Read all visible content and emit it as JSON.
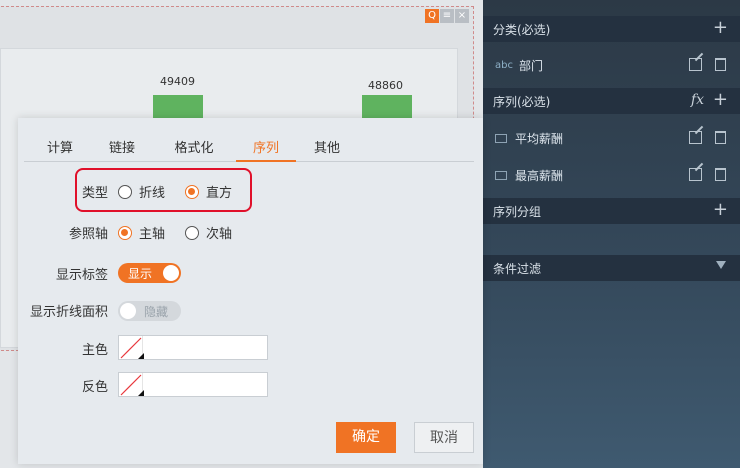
{
  "chart": {
    "bar_labels": [
      "49409",
      "48860"
    ]
  },
  "chart_data": {
    "type": "bar",
    "values": [
      49409,
      48860
    ]
  },
  "panel": {
    "category_section": "分类(必选)",
    "category_field": {
      "type_tag": "abc",
      "label": "部门"
    },
    "series_section": "序列(必选)",
    "series_fields": [
      {
        "label": "平均薪酬"
      },
      {
        "label": "最高薪酬"
      }
    ],
    "fx_label": "fx",
    "series_group_section": "序列分组",
    "filter_section": "条件过滤"
  },
  "dialog": {
    "tabs": [
      "计算",
      "链接",
      "格式化",
      "序列",
      "其他"
    ],
    "active_tab": "序列",
    "type_label": "类型",
    "type_options": [
      "折线",
      "直方"
    ],
    "type_selected": "直方",
    "axis_label": "参照轴",
    "axis_options": [
      "主轴",
      "次轴"
    ],
    "axis_selected": "主轴",
    "show_label_label": "显示标签",
    "show_label_toggle": "显示",
    "line_area_label": "显示折线面积",
    "line_area_toggle": "隐藏",
    "main_color_label": "主色",
    "inverse_color_label": "反色",
    "ok_button": "确定",
    "cancel_button": "取消"
  },
  "colors": {
    "accent": "#f07324",
    "bar": "#5fb35f",
    "highlight": "#e0102a"
  }
}
